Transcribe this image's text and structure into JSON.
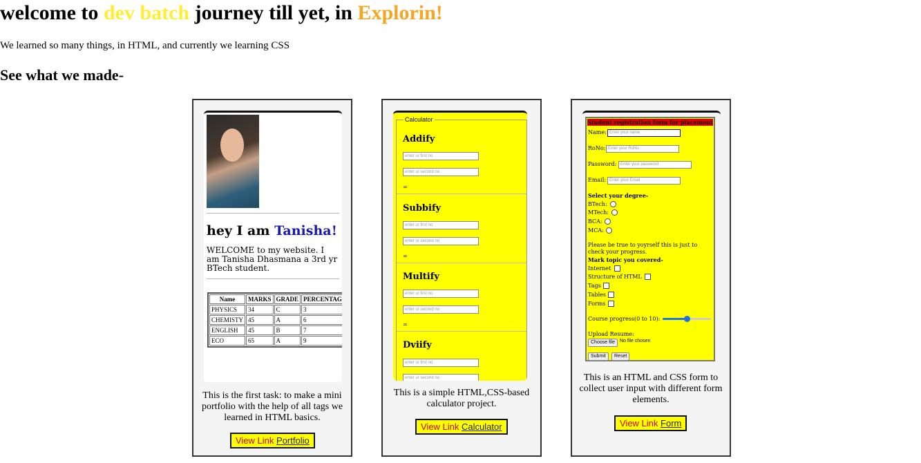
{
  "header": {
    "title_part1": "welcome to",
    "title_highlight1": "dev batch",
    "title_part2": "journey till yet, in",
    "title_highlight2": "Explorin!",
    "intro": "We learned so many things, in HTML, and currently we learning CSS",
    "subtitle": "See what we made-"
  },
  "colors": {
    "yellow_accent": "#ffee33",
    "orange_accent": "#f5a623",
    "button_bg": "#ffff00",
    "link_lead": "#d00000"
  },
  "cards": [
    {
      "preview": {
        "heading_prefix": "hey I am",
        "heading_name": "Tanisha!",
        "text": "WELCOME to my website. I am Tanisha Dhasmana a 3rd yr BTech student.",
        "table": {
          "headers": [
            "Name",
            "MARKS",
            "GRADE",
            "PERCENTAGE"
          ],
          "rows": [
            [
              "PHYSICS",
              "34",
              "C",
              "3"
            ],
            [
              "CHEMISTY",
              "45",
              "A",
              "6"
            ],
            [
              "ENGLISH",
              "45",
              "B",
              "7"
            ],
            [
              "ECO",
              "65",
              "A",
              "9"
            ]
          ]
        }
      },
      "description": "This is the first task: to make a mini portfolio with the help of all tags we learned in HTML basics.",
      "link_lead": "View Link",
      "link_name": "Portfolio"
    },
    {
      "preview": {
        "legend": "Calculator",
        "ops": [
          "Addify",
          "Subbify",
          "Multify",
          "Dviify"
        ],
        "placeholder_first": "enter ur first no",
        "placeholder_second": "enter ur second no",
        "equals": "="
      },
      "description": "This is a simple HTML,CSS-based calculator project.",
      "link_lead": "View Link",
      "link_name": "Calculator"
    },
    {
      "preview": {
        "heading": "Student registration form for placement",
        "name_label": "Name:",
        "name_placeholder": "Enter your name",
        "rono_label": "RoNo:",
        "rono_placeholder": "Enter your RoNo",
        "password_label": "Password:",
        "password_placeholder": "Enter your password",
        "email_label": "Email:",
        "email_placeholder": "Enter your Email",
        "degree_label": "Select your degree-",
        "degrees": [
          "BTech:",
          "MTech:",
          "BCA:",
          "MCA:"
        ],
        "note": "Please be true to yoyrself this is just to check your progress.",
        "topics_label": "Mark topic you covered-",
        "topics": [
          "Internet",
          "Structure of HTML",
          "Tags",
          "Tables",
          "Forms"
        ],
        "progress_label": "Course progress(0 to 10):",
        "progress_value": 5,
        "progress_max": 10,
        "resume_label": "Upload Resume:",
        "choose_file": "Choose file",
        "no_file": "No file chosen",
        "submit": "Submit",
        "reset": "Reset"
      },
      "description": "This is an HTML and CSS form to collect user input with different form elements.",
      "link_lead": "View Link",
      "link_name": "Form"
    }
  ]
}
